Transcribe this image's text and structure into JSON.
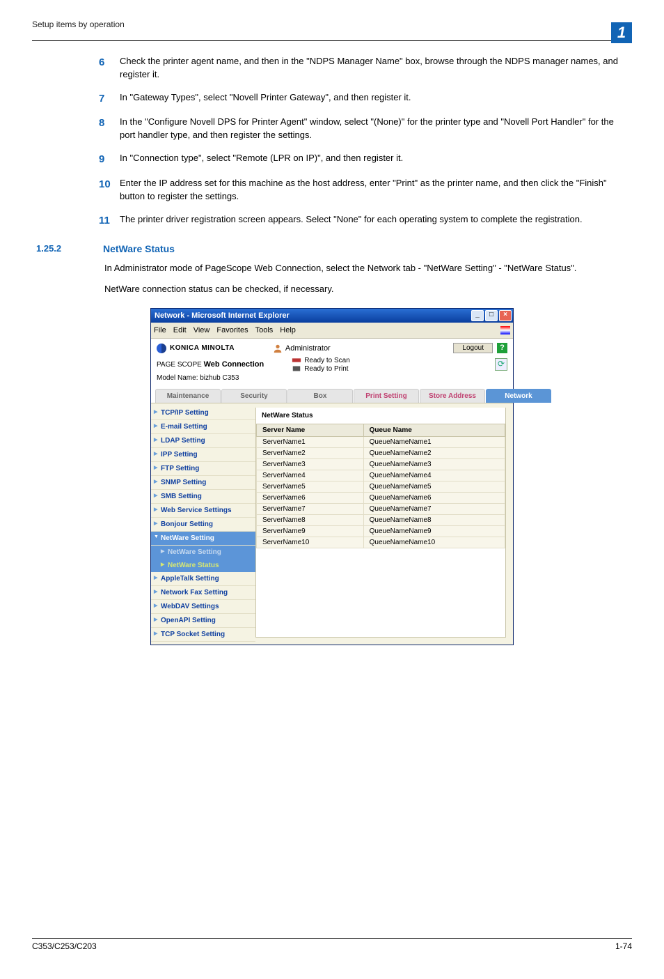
{
  "header": {
    "left": "Setup items by operation",
    "right": "1"
  },
  "steps": [
    {
      "n": "6",
      "t": "Check the printer agent name, and then in the \"NDPS Manager Name\" box, browse through the NDPS manager names, and register it."
    },
    {
      "n": "7",
      "t": "In \"Gateway Types\", select \"Novell Printer Gateway\", and then register it."
    },
    {
      "n": "8",
      "t": "In the \"Configure Novell DPS for Printer Agent\" window, select \"(None)\" for the printer type and \"Novell Port Handler\" for the port handler type, and then register the settings."
    },
    {
      "n": "9",
      "t": "In \"Connection type\", select \"Remote (LPR on IP)\", and then register it."
    },
    {
      "n": "10",
      "t": "Enter the IP address set for this machine as the host address, enter \"Print\" as the printer name, and then click the \"Finish\" button to register the settings."
    },
    {
      "n": "11",
      "t": "The printer driver registration screen appears. Select \"None\" for each operating system to complete the registration."
    }
  ],
  "section": {
    "num": "1.25.2",
    "title": "NetWare Status"
  },
  "para1": "In Administrator mode of PageScope Web Connection, select the Network tab - \"NetWare Setting\" - \"NetWare Status\".",
  "para2": "NetWare connection status can be checked, if necessary.",
  "ie": {
    "title": "Network - Microsoft Internet Explorer",
    "menu": [
      "File",
      "Edit",
      "View",
      "Favorites",
      "Tools",
      "Help"
    ],
    "brand": "KONICA MINOLTA",
    "admin": "Administrator",
    "logout": "Logout",
    "help": "?",
    "pws_a": "PAGE SCOPE",
    "pws_b": "Web Connection",
    "ready_scan": "Ready to Scan",
    "ready_print": "Ready to Print",
    "model": "Model Name: bizhub C353",
    "refresh": "⟳"
  },
  "tabs": [
    "Maintenance",
    "Security",
    "Box",
    "Print Setting",
    "Store Address",
    "Network"
  ],
  "side": {
    "items": [
      "TCP/IP Setting",
      "E-mail Setting",
      "LDAP Setting",
      "IPP Setting",
      "FTP Setting",
      "SNMP Setting",
      "SMB Setting",
      "Web Service Settings",
      "Bonjour Setting"
    ],
    "open": "NetWare Setting",
    "subs": [
      "NetWare Setting",
      "NetWare Status"
    ],
    "rest": [
      "AppleTalk Setting",
      "Network Fax Setting",
      "WebDAV Settings",
      "OpenAPI Setting",
      "TCP Socket Setting"
    ]
  },
  "content": {
    "title": "NetWare Status",
    "col1": "Server Name",
    "col2": "Queue Name",
    "rows": [
      [
        "ServerName1",
        "QueueNameName1"
      ],
      [
        "ServerName2",
        "QueueNameName2"
      ],
      [
        "ServerName3",
        "QueueNameName3"
      ],
      [
        "ServerName4",
        "QueueNameName4"
      ],
      [
        "ServerName5",
        "QueueNameName5"
      ],
      [
        "ServerName6",
        "QueueNameName6"
      ],
      [
        "ServerName7",
        "QueueNameName7"
      ],
      [
        "ServerName8",
        "QueueNameName8"
      ],
      [
        "ServerName9",
        "QueueNameName9"
      ],
      [
        "ServerName10",
        "QueueNameName10"
      ]
    ]
  },
  "footer": {
    "left": "C353/C253/C203",
    "right": "1-74"
  }
}
